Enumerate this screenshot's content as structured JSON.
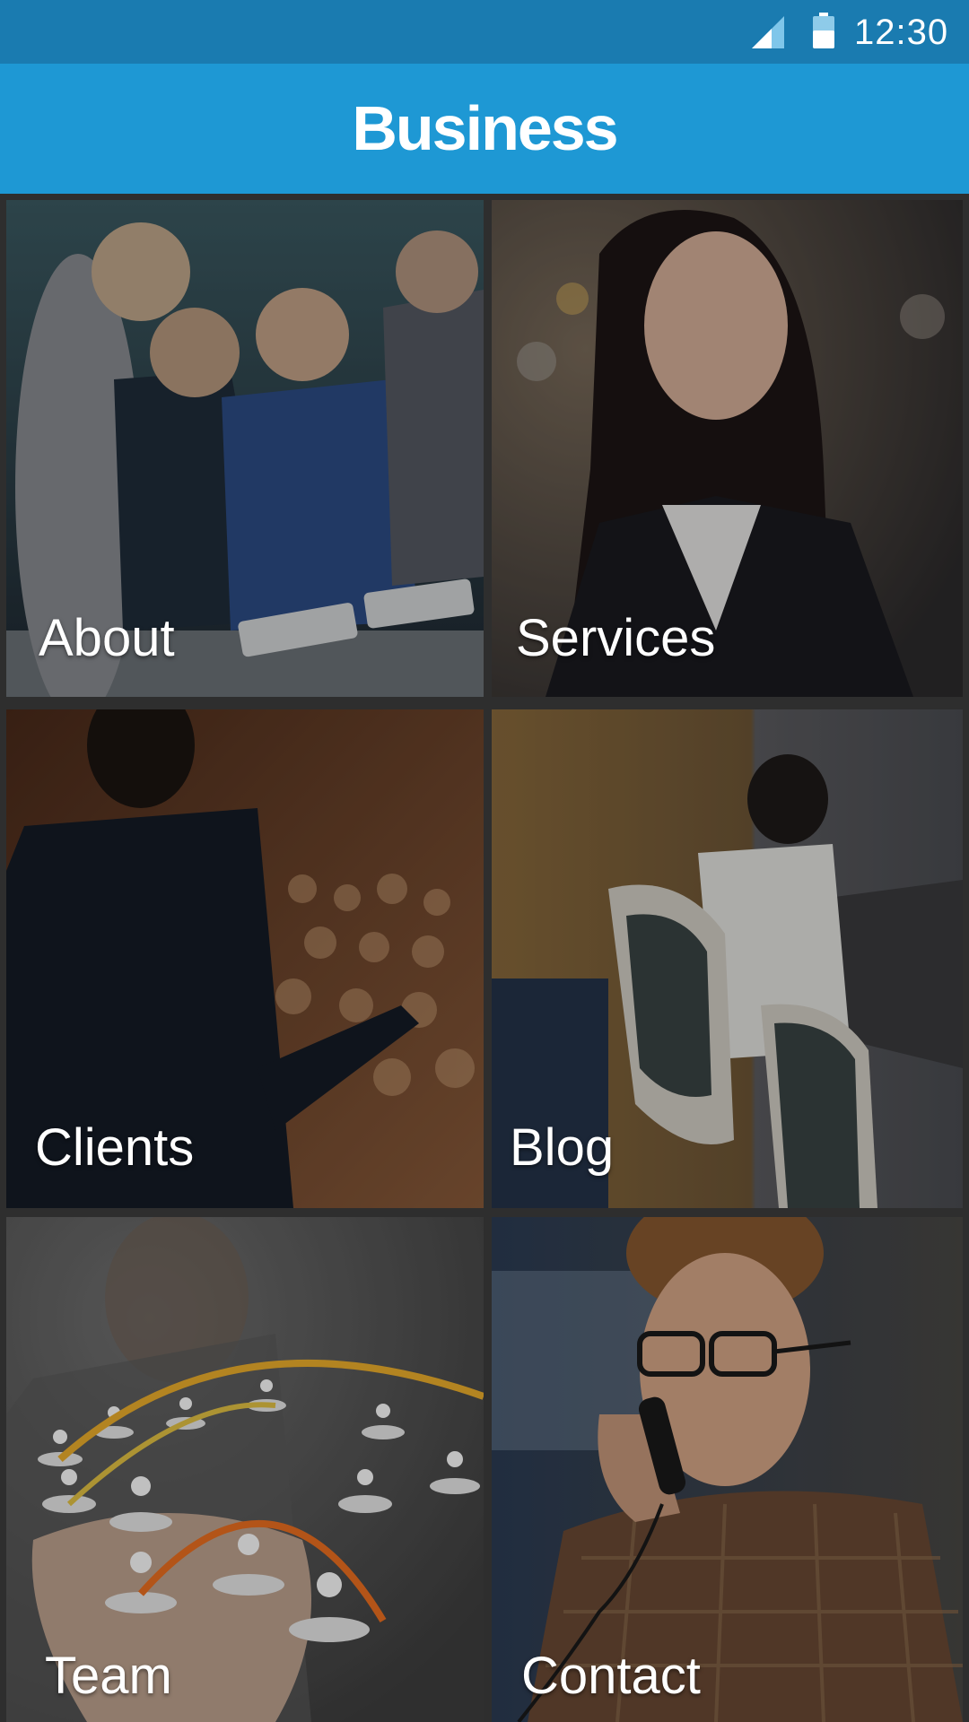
{
  "status_bar": {
    "time": "12:30",
    "icons": [
      "signal-icon",
      "battery-icon"
    ]
  },
  "app_bar": {
    "title": "Business"
  },
  "tiles": [
    {
      "label": "About",
      "image": "team-meeting-with-tablets"
    },
    {
      "label": "Services",
      "image": "smiling-businesswoman"
    },
    {
      "label": "Clients",
      "image": "speaker-at-conference"
    },
    {
      "label": "Blog",
      "image": "man-working-at-desk"
    },
    {
      "label": "Team",
      "image": "hand-with-people-network"
    },
    {
      "label": "Contact",
      "image": "man-on-telephone"
    }
  ],
  "colors": {
    "status_bar": "#1a7bb0",
    "app_bar": "#1e98d4",
    "background": "#2e2e2e"
  }
}
